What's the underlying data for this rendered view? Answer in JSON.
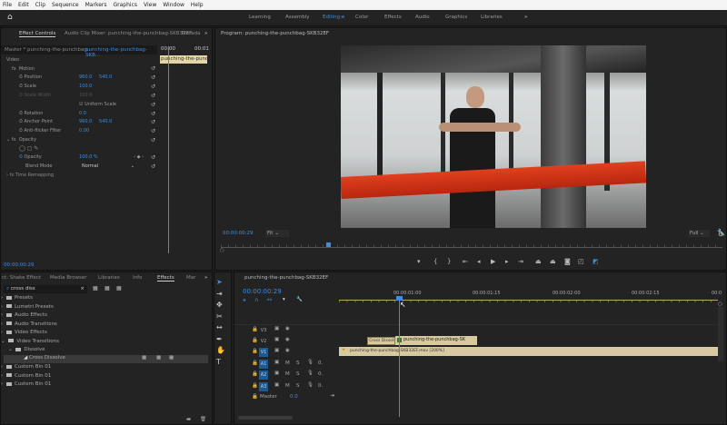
{
  "menu": [
    "File",
    "Edit",
    "Clip",
    "Sequence",
    "Markers",
    "Graphics",
    "View",
    "Window",
    "Help"
  ],
  "workspaces": {
    "items": [
      "Learning",
      "Assembly",
      "Editing",
      "Color",
      "Effects",
      "Audio",
      "Graphics",
      "Libraries"
    ],
    "active": "Editing",
    "more": "»"
  },
  "effect_controls": {
    "tabs": [
      "Effect Controls",
      "Audio Clip Mixer: punching-the-punchbag-SKB32EF",
      "Metada"
    ],
    "more": "»",
    "master": "Master * punching-the-punchbag...",
    "clip": "punching-the-punchbag-SKB...",
    "mini_times": [
      "00:00",
      "00:01"
    ],
    "mini_clip": "punching-the-punchba",
    "video_label": "Video",
    "motion": "Motion",
    "position": {
      "label": "Position",
      "x": "960.0",
      "y": "540.0"
    },
    "scale": {
      "label": "Scale",
      "value": "100.0"
    },
    "scale_width": {
      "label": "Scale Width",
      "value": "100.0"
    },
    "uniform_scale": "Uniform Scale",
    "rotation": {
      "label": "Rotation",
      "value": "0.0"
    },
    "anchor": {
      "label": "Anchor Point",
      "x": "960.0",
      "y": "540.0"
    },
    "antiflicker": {
      "label": "Anti-flicker Filter",
      "value": "0.00"
    },
    "opacity_group": "Opacity",
    "opacity": {
      "label": "Opacity",
      "value": "100.0 %"
    },
    "blend": {
      "label": "Blend Mode",
      "value": "Normal"
    },
    "time_remap": "Time Remapping",
    "timecode": "00:00:00:29"
  },
  "program": {
    "title": "Program: punching-the-punchbag-SKB32EF",
    "timecode": "00:00:00:29",
    "fit": "Fit",
    "quality": "Full"
  },
  "effects_panel": {
    "tabs": [
      "ct: Shake Effect",
      "Media Browser",
      "Libraries",
      "Info",
      "Effects",
      "Mar"
    ],
    "more": "»",
    "search": "cross diss",
    "items": [
      "Presets",
      "Lumetri Presets",
      "Audio Effects",
      "Audio Transitions",
      "Video Effects",
      "Video Transitions",
      "Dissolve",
      "Cross Dissolve",
      "Custom Bin 01",
      "Custom Bin 01",
      "Custom Bin 01"
    ]
  },
  "timeline": {
    "title": "punching-the-punchbag-SKB32EF",
    "timecode": "00:00:00:29",
    "ruler": [
      "00:00:01:00",
      "00:00:01:15",
      "00:00:02:00",
      "00:00:02:15",
      "00:0"
    ],
    "tracks": [
      "V3",
      "V2",
      "V1",
      "A1",
      "A2",
      "A3"
    ],
    "master": "Master",
    "master_val": "0.0",
    "transition": "Cross Dissolve",
    "clip_v2": "punching-the-punchbag-SK",
    "clip_v1": "punching-the-punchbag-SKB32EF.mov [200%]"
  },
  "colors": {
    "accent": "#3d8ee0",
    "clip": "#d8c9a0",
    "ruler": "#b8aa56"
  }
}
